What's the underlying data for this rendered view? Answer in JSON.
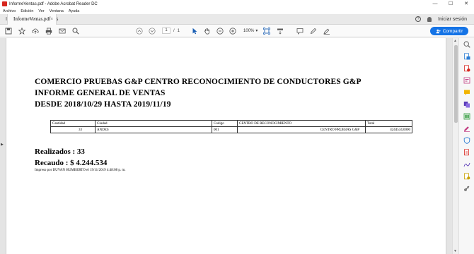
{
  "window": {
    "title": "InformeVentas.pdf - Adobe Acrobat Reader DC",
    "minimize": "—",
    "maximize": "☐",
    "close": "✕"
  },
  "menu": [
    "Archivo",
    "Edición",
    "Ver",
    "Ventana",
    "Ayuda"
  ],
  "tabs": {
    "home": "Inicio",
    "tools": "Herramientas",
    "document": "InformeVentas.pdf",
    "close": "×"
  },
  "account": {
    "help": "?",
    "signin": "Iniciar sesión"
  },
  "toolbar": {
    "page_current": "1",
    "page_sep": "/",
    "page_total": "1",
    "zoom": "100%",
    "zoom_caret": "▾",
    "share_label": "Compartir"
  },
  "report": {
    "line1": "COMERCIO PRUEBAS G&P CENTRO RECONOCIMIENTO DE CONDUCTORES G&P",
    "line2": "INFORME GENERAL DE VENTAS",
    "line3": "DESDE 2018/10/29 HASTA 2019/11/19",
    "table": {
      "headers": [
        "Cantidad",
        "Ciudad",
        "Codigo",
        "CENTRO DE RECONOCIMIENTO",
        "Total"
      ],
      "rows": [
        [
          "33",
          "ANDES",
          "001",
          "CENTRO PRUEBAS G&P",
          "4244534,0000"
        ]
      ]
    },
    "realizados": "Realizados : 33",
    "recaudo": "Recaudo : $ 4.244.534",
    "printed": "Impreso por DUVAN HUMBERTO el 19/11/2019 4:48:08 p. m."
  },
  "scroll": {
    "up": "▲",
    "down": "▼",
    "left": "◀",
    "right": "▶"
  },
  "colors": {
    "accent": "#1473e6",
    "pdf_red": "#d7261e"
  }
}
